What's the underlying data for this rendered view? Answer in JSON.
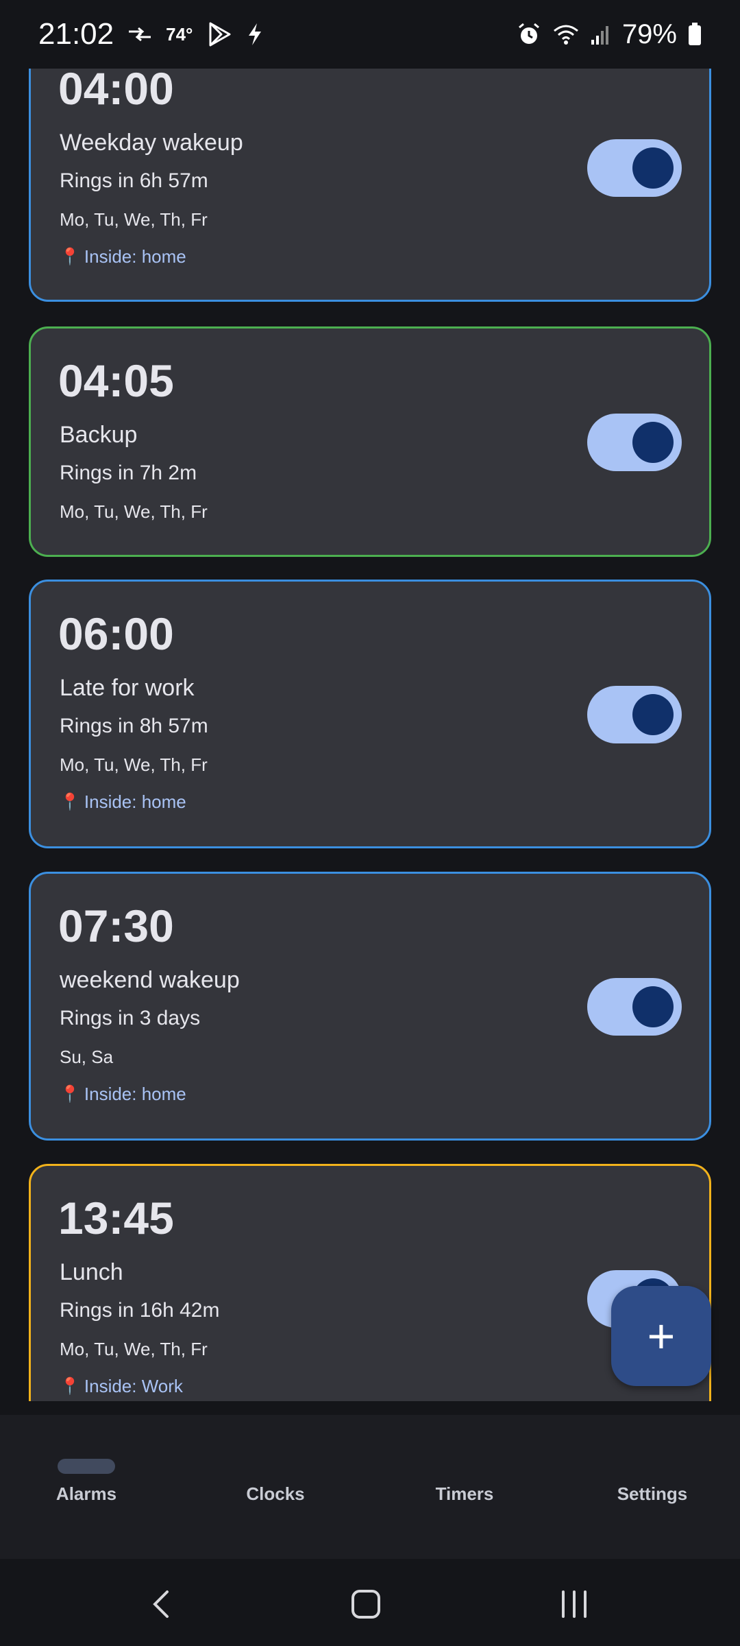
{
  "status_bar": {
    "time": "21:02",
    "temperature": "74°",
    "battery": "79%"
  },
  "alarms": [
    {
      "time": "04:00",
      "label": "Weekday wakeup",
      "rings": "Rings in 6h 57m",
      "days": "Mo, Tu, We, Th, Fr",
      "location": "Inside: home",
      "enabled": true,
      "border_color": "#3b8fe0"
    },
    {
      "time": "04:05",
      "label": "Backup",
      "rings": "Rings in 7h 2m",
      "days": "Mo, Tu, We, Th, Fr",
      "location": "",
      "enabled": true,
      "border_color": "#4caf50"
    },
    {
      "time": "06:00",
      "label": "Late for work",
      "rings": "Rings in 8h 57m",
      "days": "Mo, Tu, We, Th, Fr",
      "location": "Inside: home",
      "enabled": true,
      "border_color": "#3b8fe0"
    },
    {
      "time": "07:30",
      "label": "weekend wakeup",
      "rings": "Rings in 3 days",
      "days": "Su, Sa",
      "location": "Inside: home",
      "enabled": true,
      "border_color": "#3b8fe0"
    },
    {
      "time": "13:45",
      "label": "Lunch",
      "rings": "Rings in 16h 42m",
      "days": "Mo, Tu, We, Th, Fr",
      "location": "Inside: Work",
      "enabled": true,
      "border_color": "#f2b21b"
    }
  ],
  "fab": {
    "icon": "plus-icon",
    "label": "+"
  },
  "bottom_nav": {
    "items": [
      {
        "label": "Alarms",
        "selected": true
      },
      {
        "label": "Clocks",
        "selected": false
      },
      {
        "label": "Timers",
        "selected": false
      },
      {
        "label": "Settings",
        "selected": false
      }
    ]
  },
  "system_nav": {
    "buttons": [
      "back-icon",
      "home-icon",
      "recents-icon"
    ]
  },
  "colors": {
    "card_bg": "#34353b",
    "toggle_track": "#a9c3f5",
    "toggle_knob": "#10306a",
    "location_text": "#a9c3f5",
    "fab_bg": "#2e4c88"
  }
}
